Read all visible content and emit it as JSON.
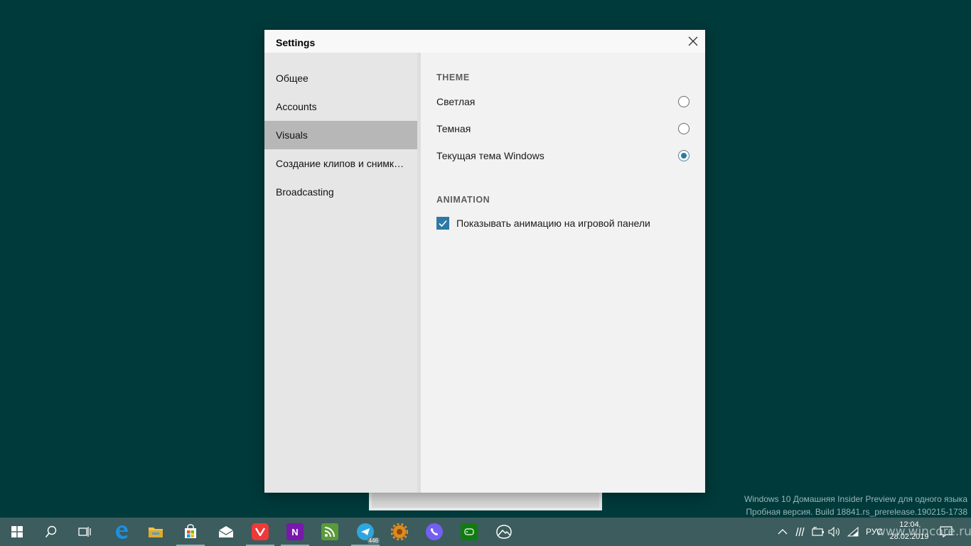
{
  "dialog": {
    "title": "Settings",
    "nav": [
      {
        "label": "Общее",
        "active": false
      },
      {
        "label": "Accounts",
        "active": false
      },
      {
        "label": "Visuals",
        "active": true
      },
      {
        "label": "Создание клипов и снимков экрана",
        "active": false
      },
      {
        "label": "Broadcasting",
        "active": false
      }
    ],
    "theme": {
      "heading": "THEME",
      "options": [
        {
          "label": "Светлая",
          "checked": false
        },
        {
          "label": "Темная",
          "checked": false
        },
        {
          "label": "Текущая тема Windows",
          "checked": true
        }
      ]
    },
    "animation": {
      "heading": "ANIMATION",
      "checkbox_label": "Показывать анимацию на игровой панели",
      "checked": true
    }
  },
  "watermark": {
    "line1": "Windows 10 Домашняя Insider Preview для одного языка",
    "line2": "Пробная версия. Build 18841.rs_prerelease.190215-1738"
  },
  "taskbar": {
    "apps": [
      {
        "name": "start-icon"
      },
      {
        "name": "search-icon"
      },
      {
        "name": "task-view-icon"
      },
      {
        "name": "edge-icon"
      },
      {
        "name": "file-explorer-icon"
      },
      {
        "name": "store-icon"
      },
      {
        "name": "mail-icon"
      },
      {
        "name": "vivaldi-icon"
      },
      {
        "name": "onenote-icon",
        "label": "N"
      },
      {
        "name": "feed-reader-icon"
      },
      {
        "name": "telegram-icon",
        "badge": "446"
      },
      {
        "name": "settings-gear-app-icon"
      },
      {
        "name": "viber-icon"
      },
      {
        "name": "xbox-game-bar-icon"
      },
      {
        "name": "photos-icon"
      }
    ],
    "tray": {
      "language": "РУС",
      "time": "12:04",
      "date": "28.02.2019"
    },
    "site": "www.wincore.ru"
  },
  "colors": {
    "desktop": "#003a3b",
    "taskbar": "#3c5c5d",
    "accent": "#2d79a6"
  }
}
